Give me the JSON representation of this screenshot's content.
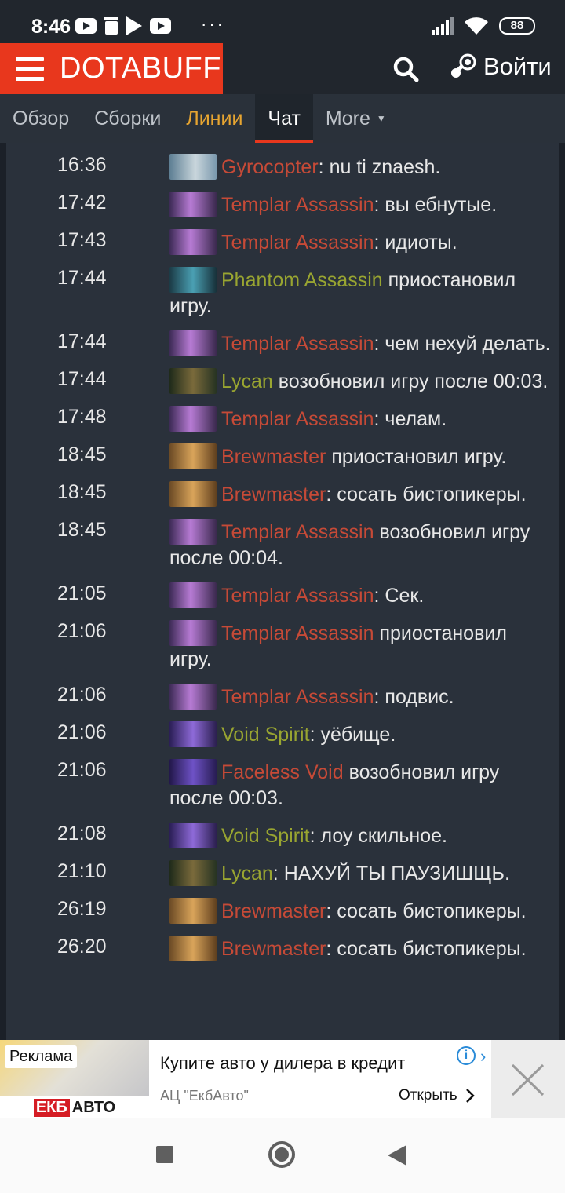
{
  "status_bar": {
    "time": "8:46",
    "battery": "88",
    "more_dots": "···"
  },
  "header": {
    "brand": "DOTABUFF",
    "login": "Войти"
  },
  "tabs": [
    {
      "label": "Обзор"
    },
    {
      "label": "Сборки"
    },
    {
      "label": "Линии"
    },
    {
      "label": "Чат"
    },
    {
      "label": "More"
    }
  ],
  "chat": [
    {
      "time": "16:36",
      "hero": "Gyrocopter",
      "team": "dire",
      "text": ": nu ti znaesh.",
      "avatar": "gyrocopter-portrait"
    },
    {
      "time": "17:42",
      "hero": "Templar Assassin",
      "team": "dire",
      "text": ": вы ебнутые.",
      "avatar": "templar-assassin-portrait"
    },
    {
      "time": "17:43",
      "hero": "Templar Assassin",
      "team": "dire",
      "text": ": идиоты.",
      "avatar": "templar-assassin-portrait"
    },
    {
      "time": "17:44",
      "hero": "Phantom Assassin",
      "team": "radiant",
      "text": " приостановил игру.",
      "avatar": "phantom-assassin-portrait"
    },
    {
      "time": "17:44",
      "hero": "Templar Assassin",
      "team": "dire",
      "text": ": чем нехуй делать.",
      "avatar": "templar-assassin-portrait"
    },
    {
      "time": "17:44",
      "hero": "Lycan",
      "team": "radiant",
      "text": " возобновил игру после 00:03.",
      "avatar": "lycan-portrait"
    },
    {
      "time": "17:48",
      "hero": "Templar Assassin",
      "team": "dire",
      "text": ": челам.",
      "avatar": "templar-assassin-portrait"
    },
    {
      "time": "18:45",
      "hero": "Brewmaster",
      "team": "dire",
      "text": " приостановил игру.",
      "avatar": "brewmaster-portrait"
    },
    {
      "time": "18:45",
      "hero": "Brewmaster",
      "team": "dire",
      "text": ": сосать бистопикеры.",
      "avatar": "brewmaster-portrait"
    },
    {
      "time": "18:45",
      "hero": "Templar Assassin",
      "team": "dire",
      "text": " возобновил игру после 00:04.",
      "avatar": "templar-assassin-portrait"
    },
    {
      "time": "21:05",
      "hero": "Templar Assassin",
      "team": "dire",
      "text": ": Сек.",
      "avatar": "templar-assassin-portrait"
    },
    {
      "time": "21:06",
      "hero": "Templar Assassin",
      "team": "dire",
      "text": " приостановил игру.",
      "avatar": "templar-assassin-portrait"
    },
    {
      "time": "21:06",
      "hero": "Templar Assassin",
      "team": "dire",
      "text": ": подвис.",
      "avatar": "templar-assassin-portrait"
    },
    {
      "time": "21:06",
      "hero": "Void Spirit",
      "team": "radiant",
      "text": ": уёбище.",
      "avatar": "void-spirit-portrait"
    },
    {
      "time": "21:06",
      "hero": "Faceless Void",
      "team": "dire",
      "text": " возобновил игру после 00:03.",
      "avatar": "faceless-void-portrait"
    },
    {
      "time": "21:08",
      "hero": "Void Spirit",
      "team": "radiant",
      "text": ": лоу скильное.",
      "avatar": "void-spirit-portrait"
    },
    {
      "time": "21:10",
      "hero": "Lycan",
      "team": "radiant",
      "text": ": НАХУЙ ТЫ ПАУЗИШЩЬ.",
      "avatar": "lycan-portrait"
    },
    {
      "time": "26:19",
      "hero": "Brewmaster",
      "team": "dire",
      "text": ": сосать бистопикеры.",
      "avatar": "brewmaster-portrait"
    },
    {
      "time": "26:20",
      "hero": "Brewmaster",
      "team": "dire",
      "text": ": сосать бистопикеры.",
      "avatar": "brewmaster-portrait"
    }
  ],
  "ad": {
    "label": "Реклама",
    "title": "Купите авто у дилера в кредит",
    "advertiser": "АЦ \"ЕкбАвто\"",
    "open": "Открыть",
    "brand_red": "ЕКБ",
    "brand_dark": "АВТО"
  },
  "colors": {
    "accent": "#e8371d",
    "radiant": "#99a531",
    "dire": "#c64a37",
    "lines_tab": "#e7a531"
  }
}
